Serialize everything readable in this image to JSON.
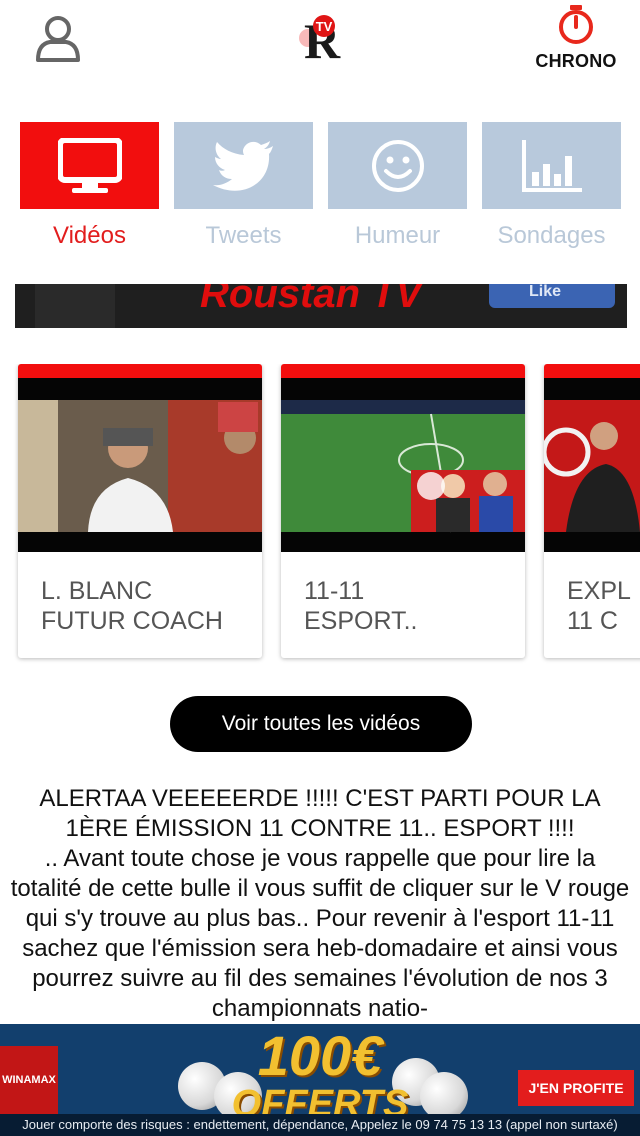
{
  "header": {
    "user_icon": "user-icon",
    "logo_icon": "rtv-logo",
    "logo_text": "TV",
    "chrono_icon": "stopwatch-icon",
    "chrono_label": "CHRONO"
  },
  "tabs": [
    {
      "label": "Vidéos",
      "icon": "monitor-icon",
      "active": true
    },
    {
      "label": "Tweets",
      "icon": "twitter-bird-icon",
      "active": false
    },
    {
      "label": "Humeur",
      "icon": "smiley-icon",
      "active": false
    },
    {
      "label": "Sondages",
      "icon": "bar-chart-icon",
      "active": false
    }
  ],
  "banner": {
    "title": "Roustan TV",
    "like_label": "Like"
  },
  "videos": [
    {
      "title": "L. BLANC\nFUTUR COACH"
    },
    {
      "title": "11-11\nESPORT.."
    },
    {
      "title": "EXPL\n11 C"
    }
  ],
  "all_videos_button": "Voir toutes les vidéos",
  "article": {
    "headline": "ALERTAA VEEEEERDE !!!!! C'EST PARTI POUR LA 1ÈRE ÉMISSION 11 CONTRE 11.. ESPORT !!!!",
    "body": ".. Avant toute chose je vous rappelle que pour lire la totalité de cette bulle il vous suffit de cliquer sur le V rouge qui s'y trouve au plus bas.. Pour revenir à l'esport 11-11 sachez que l'émission sera heb-domadaire et ainsi vous pourrez suivre au fil des semaines l'évolution de nos 3 championnats natio-"
  },
  "ad": {
    "brand": "WINAMAX",
    "amount": "100€",
    "offer": "OFFERTS",
    "cta": "J'EN PROFITE",
    "disclaimer": "Jouer comporte des risques : endettement, dépendance, Appelez le 09 74 75 13 13 (appel non surtaxé)"
  },
  "colors": {
    "accent": "#f20e0e",
    "tab_inactive": "#b8c9dc",
    "tab_label_inactive": "#b9c8d8"
  }
}
